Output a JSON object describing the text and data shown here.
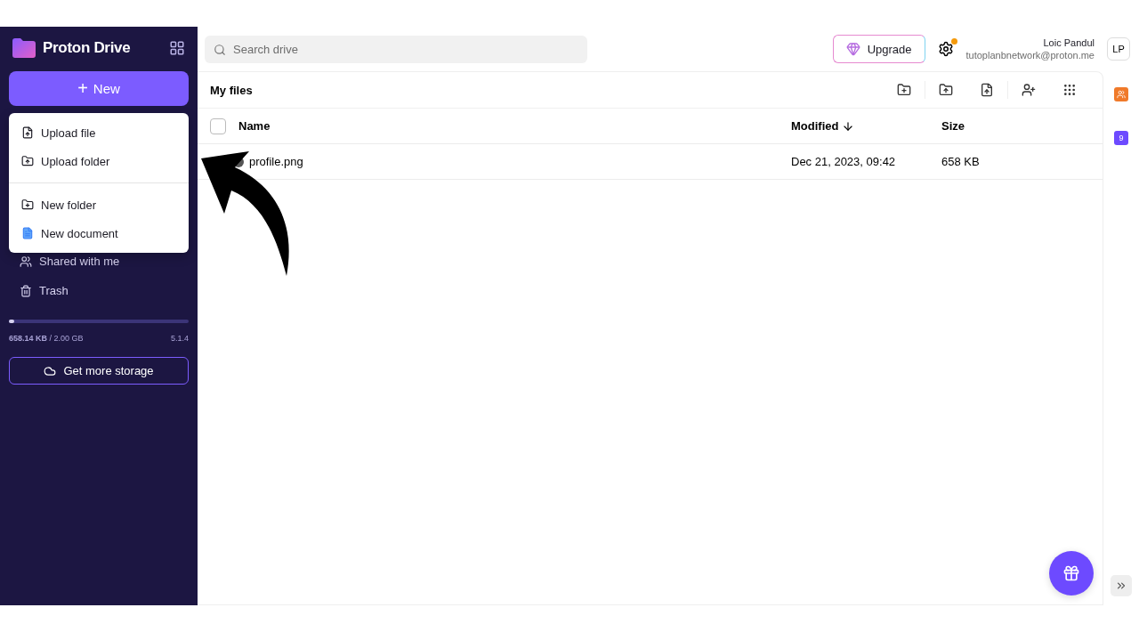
{
  "brand": {
    "name": "Proton Drive"
  },
  "new_button": {
    "label": "New",
    "icon": "+"
  },
  "new_menu": {
    "groups": [
      [
        {
          "label": "Upload file",
          "kind": "upload-file"
        },
        {
          "label": "Upload folder",
          "kind": "upload-folder"
        }
      ],
      [
        {
          "label": "New folder",
          "kind": "new-folder"
        },
        {
          "label": "New document",
          "kind": "document"
        }
      ]
    ]
  },
  "sidebar": {
    "items": [
      {
        "label": "Shared with me",
        "kind": "shared",
        "selected": false
      },
      {
        "label": "Trash",
        "kind": "trash",
        "selected": false
      }
    ]
  },
  "storage": {
    "level": 0.02,
    "usage": "**658.14 KB** / 2.00 GB",
    "version": "5.1.4",
    "button": "Get more storage"
  },
  "search": {
    "placeholder": "Search drive"
  },
  "header": {
    "upgrade": "Upgrade",
    "settings_alert": true,
    "user_name": "Loic Pandul",
    "user_email": "tutoplanbnetwork@proton.me",
    "avatar": "LP"
  },
  "toolbar": {
    "title": "My files"
  },
  "table": {
    "columns": [
      {
        "label": "Name",
        "sorted": false
      },
      {
        "label": "Modified",
        "sorted": true
      },
      {
        "label": "Size",
        "sorted": false
      }
    ],
    "all_checked": false,
    "rows": [
      {
        "name": "profile.png",
        "modified": "Dec 21, 2023, 09:42",
        "size": "658 KB",
        "selected": false
      }
    ]
  },
  "rail": {
    "badge": "9"
  }
}
